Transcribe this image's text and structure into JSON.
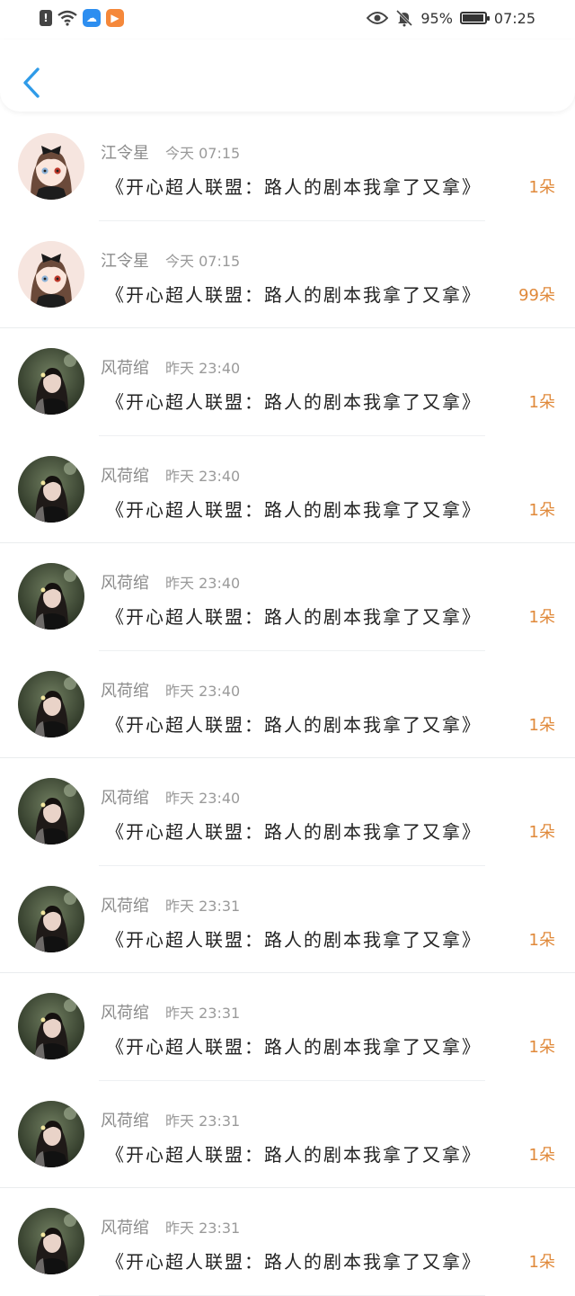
{
  "status_bar": {
    "battery": "95%",
    "time": "07:25",
    "battery_level": 0.95
  },
  "items": [
    {
      "name": "江令星",
      "time": "今天 07:15",
      "book": "《开心超人联盟：路人的剧本我拿了又拿》",
      "count": "1朵",
      "avatar": "anime-girl-avatar"
    },
    {
      "name": "江令星",
      "time": "今天 07:15",
      "book": "《开心超人联盟：路人的剧本我拿了又拿》",
      "count": "99朵",
      "avatar": "anime-girl-avatar"
    },
    {
      "name": "风荷绾",
      "time": "昨天 23:40",
      "book": "《开心超人联盟：路人的剧本我拿了又拿》",
      "count": "1朵",
      "avatar": "photo-girl-avatar"
    },
    {
      "name": "风荷绾",
      "time": "昨天 23:40",
      "book": "《开心超人联盟：路人的剧本我拿了又拿》",
      "count": "1朵",
      "avatar": "photo-girl-avatar"
    },
    {
      "name": "风荷绾",
      "time": "昨天 23:40",
      "book": "《开心超人联盟：路人的剧本我拿了又拿》",
      "count": "1朵",
      "avatar": "photo-girl-avatar"
    },
    {
      "name": "风荷绾",
      "time": "昨天 23:40",
      "book": "《开心超人联盟：路人的剧本我拿了又拿》",
      "count": "1朵",
      "avatar": "photo-girl-avatar"
    },
    {
      "name": "风荷绾",
      "time": "昨天 23:40",
      "book": "《开心超人联盟：路人的剧本我拿了又拿》",
      "count": "1朵",
      "avatar": "photo-girl-avatar"
    },
    {
      "name": "风荷绾",
      "time": "昨天 23:31",
      "book": "《开心超人联盟：路人的剧本我拿了又拿》",
      "count": "1朵",
      "avatar": "photo-girl-avatar"
    },
    {
      "name": "风荷绾",
      "time": "昨天 23:31",
      "book": "《开心超人联盟：路人的剧本我拿了又拿》",
      "count": "1朵",
      "avatar": "photo-girl-avatar"
    },
    {
      "name": "风荷绾",
      "time": "昨天 23:31",
      "book": "《开心超人联盟：路人的剧本我拿了又拿》",
      "count": "1朵",
      "avatar": "photo-girl-avatar"
    },
    {
      "name": "风荷绾",
      "time": "昨天 23:31",
      "book": "《开心超人联盟：路人的剧本我拿了又拿》",
      "count": "1朵",
      "avatar": "photo-girl-avatar"
    }
  ],
  "colors": {
    "accent_back": "#2f9be8",
    "count": "#e0893a"
  }
}
